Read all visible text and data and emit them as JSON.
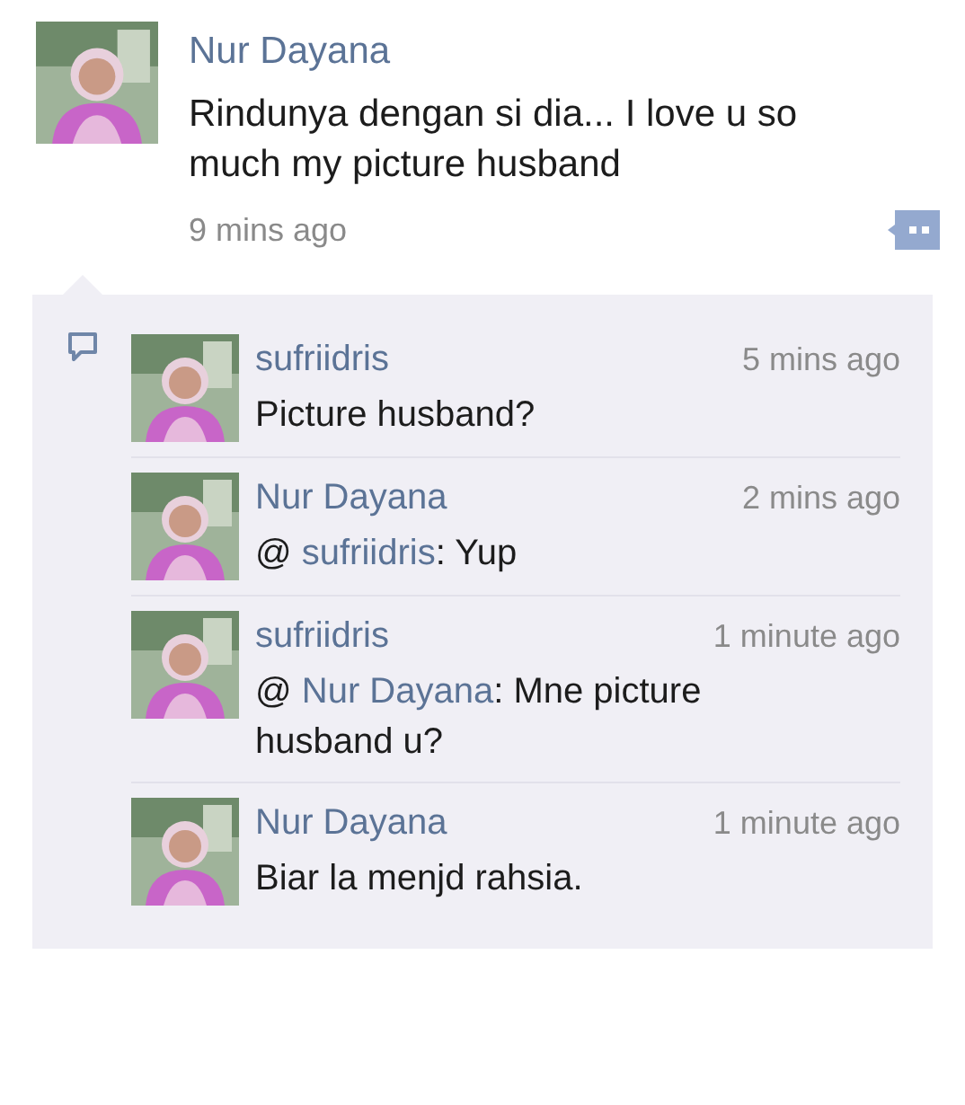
{
  "post": {
    "author": "Nur Dayana",
    "text": "Rindunya dengan si dia... I love u so much my picture husband",
    "time": "9 mins ago"
  },
  "comments": [
    {
      "author": "sufriidris",
      "time": "5 mins ago",
      "text": "Picture husband?"
    },
    {
      "author": "Nur Dayana",
      "time": "2 mins ago",
      "mention_prefix": "@",
      "mention": "sufriidris",
      "text": ": Yup"
    },
    {
      "author": "sufriidris",
      "time": "1 minute ago",
      "mention_prefix": "@",
      "mention": "Nur Dayana",
      "text": ": Mne picture husband u?"
    },
    {
      "author": "Nur Dayana",
      "time": "1 minute ago",
      "text": "Biar la menjd rahsia."
    }
  ]
}
